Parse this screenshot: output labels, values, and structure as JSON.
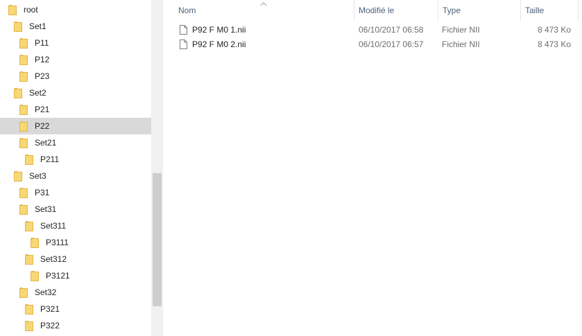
{
  "tree": [
    {
      "label": "root",
      "level": 0,
      "selected": false
    },
    {
      "label": "Set1",
      "level": 1,
      "selected": false
    },
    {
      "label": "P11",
      "level": 2,
      "selected": false
    },
    {
      "label": "P12",
      "level": 2,
      "selected": false
    },
    {
      "label": "P23",
      "level": 2,
      "selected": false
    },
    {
      "label": "Set2",
      "level": 1,
      "selected": false
    },
    {
      "label": "P21",
      "level": 2,
      "selected": false
    },
    {
      "label": "P22",
      "level": 2,
      "selected": true
    },
    {
      "label": "Set21",
      "level": 2,
      "selected": false
    },
    {
      "label": "P211",
      "level": 3,
      "selected": false
    },
    {
      "label": "Set3",
      "level": 1,
      "selected": false
    },
    {
      "label": "P31",
      "level": 2,
      "selected": false
    },
    {
      "label": "Set31",
      "level": 2,
      "selected": false
    },
    {
      "label": "Set311",
      "level": 3,
      "selected": false
    },
    {
      "label": "P3111",
      "level": 4,
      "selected": false
    },
    {
      "label": "Set312",
      "level": 3,
      "selected": false
    },
    {
      "label": "P3121",
      "level": 4,
      "selected": false
    },
    {
      "label": "Set32",
      "level": 2,
      "selected": false
    },
    {
      "label": "P321",
      "level": 3,
      "selected": false
    },
    {
      "label": "P322",
      "level": 3,
      "selected": false
    }
  ],
  "columns": {
    "name": "Nom",
    "modified": "Modifié le",
    "type": "Type",
    "size": "Taille"
  },
  "files": [
    {
      "name": "P92 F M0 1.nii",
      "modified": "06/10/2017 06:58",
      "type": "Fichier NII",
      "size": "8 473 Ko"
    },
    {
      "name": "P92 F M0 2.nii",
      "modified": "06/10/2017 06:57",
      "type": "Fichier NII",
      "size": "8 473 Ko"
    }
  ],
  "icons": {
    "folder": "folder-icon",
    "file": "file-icon",
    "sort": "sort-up-icon"
  },
  "colors": {
    "selection": "#d9d9d9",
    "folder": "#f8d775",
    "header_text": "#4c607a"
  }
}
